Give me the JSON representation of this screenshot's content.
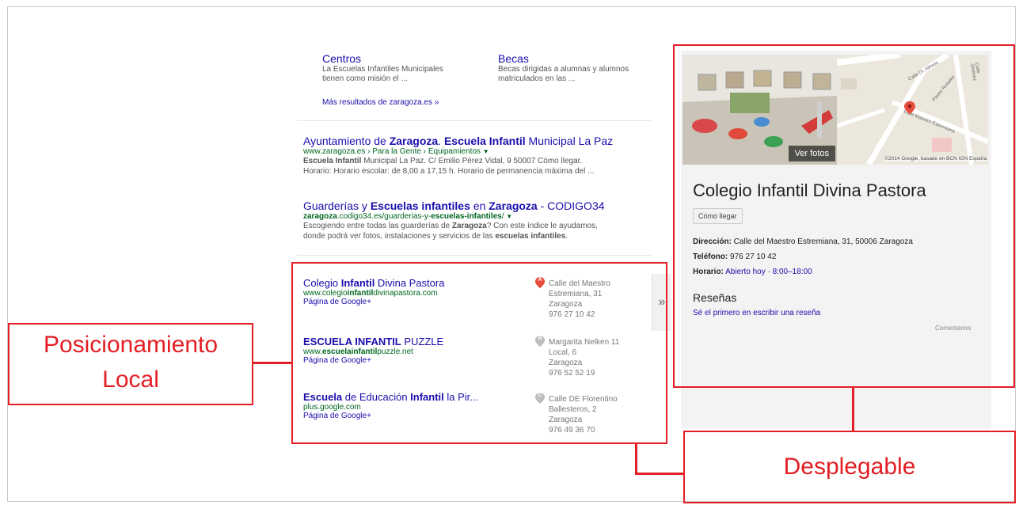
{
  "sitelinks": [
    {
      "title": "Centros",
      "desc1": "La Escuelas Infantiles Municipales",
      "desc2": "tienen como misión el ..."
    },
    {
      "title": "Becas",
      "desc1": "Becas dirigidas a alumnas y alumnos",
      "desc2": "matriculados en las ..."
    }
  ],
  "more_results": "Más resultados de zaragoza.es »",
  "results": [
    {
      "title_parts": [
        "Ayuntamiento de ",
        "Zaragoza",
        ". ",
        "Escuela Infantil",
        " Municipal La Paz"
      ],
      "url": "www.zaragoza.es › Para la Gente › Equipamientos",
      "snippet1_bold": "Escuela Infantil",
      "snippet1_rest": " Municipal La Paz. C/ Emilio Pérez Vidal, 9 50007 Cómo llegar.",
      "snippet2": "Horario: Horario escolar: de 8,00 a 17,15 h. Horario de permanencia máxima del ..."
    },
    {
      "title_parts": [
        "Guarderías y ",
        "Escuelas infantiles",
        " en ",
        "Zaragoza",
        " - CODIGO34"
      ],
      "url_bold1": "zaragoza",
      "url_mid": ".codigo34.es/guarderias-y-",
      "url_bold2": "escuelas-infantiles",
      "url_end": "/",
      "snippet1_a": "Escogiendo entre todas las guarderías de ",
      "snippet1_b": "Zaragoza",
      "snippet1_c": "? Con este índice le ayudamos,",
      "snippet2_a": "donde podrá ver fotos, instalaciones y servicios de las ",
      "snippet2_b": "escuelas infantiles",
      "snippet2_c": "."
    }
  ],
  "local": [
    {
      "title_parts": [
        "Colegio ",
        "Infantil",
        " Divina Pastora"
      ],
      "url_parts": [
        "www.colegio",
        "infantil",
        "divinapastora.com"
      ],
      "link": "Página de Google+",
      "pin": "A",
      "addr": [
        "Calle del Maestro",
        "Estremiana, 31",
        "Zaragoza",
        "976 27 10 42"
      ]
    },
    {
      "title_parts": [
        "ESCUELA INFANTIL",
        " PUZZLE"
      ],
      "url_parts": [
        "www.",
        "escuelainfantil",
        "puzzle.net"
      ],
      "link": "Página de Google+",
      "pin": "B",
      "addr": [
        "Margarita Nelken 11",
        "Local, 6",
        "Zaragoza",
        "976 52 52 19"
      ]
    },
    {
      "title_parts": [
        "Escuela",
        " de Educación ",
        "Infantil",
        " la Pir..."
      ],
      "url_parts": [
        "plus.google.com",
        "",
        ""
      ],
      "link": "Página de Google+",
      "pin": "C",
      "addr": [
        "Calle DE Florentino",
        "Ballesteros, 2",
        "Zaragoza",
        "976 49 36 70"
      ]
    }
  ],
  "expand_glyph": "»",
  "knowledge_panel": {
    "photos_label": "Ver fotos",
    "map_credit": "©2014 Google, basado en BCN IGN España",
    "map_streets": [
      "Calle Dr. Alfredo",
      "Paseo Rosales",
      "Calle Maestro Estremiana",
      "Calle Jiménez"
    ],
    "title": "Colegio Infantil Divina Pastora",
    "directions_btn": "Cómo llegar",
    "address_label": "Dirección:",
    "address_value": " Calle del Maestro Estremiana, 31, 50006 Zaragoza",
    "phone_label": "Teléfono:",
    "phone_value": " 976 27 10 42",
    "hours_label": "Horario:",
    "hours_open": " Abierto hoy",
    "hours_sep": " · ",
    "hours_value": "8:00–18:00",
    "reviews_title": "Reseñas",
    "write_review": "Sé el primero en escribir una reseña",
    "feedback": "Comentarios"
  },
  "annotations": {
    "local_label": [
      "Posicionamiento",
      "Local"
    ],
    "panel_label": "Desplegable"
  },
  "colors": {
    "accent_red": "#e31e24",
    "link_blue": "#1a0dab",
    "url_green": "#006621"
  }
}
